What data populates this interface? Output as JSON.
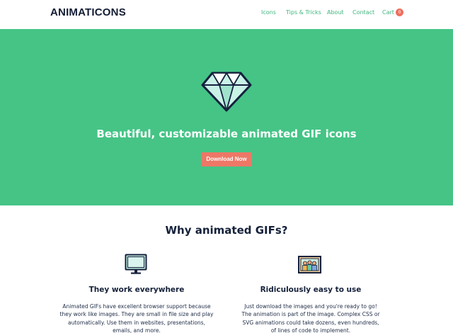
{
  "header": {
    "logo": "ANIMATICONS",
    "nav": {
      "icons": "Icons",
      "tips": "Tips & Tricks",
      "about": "About",
      "contact": "Contact",
      "cart": "Cart",
      "cart_count": "0"
    }
  },
  "hero": {
    "icon": "diamond-icon",
    "title": "Beautiful, customizable animated GIF icons",
    "button": "Download Now"
  },
  "why": {
    "title": "Why animated GIFs?",
    "features": [
      {
        "icon": "monitor-icon",
        "title": "They work everywhere",
        "text": "Animated GIFs have excellent browser support because they work like images. They are small in file size and play automatically. Use them in websites, presentations, emails, and more."
      },
      {
        "icon": "picture-icon",
        "title": "Ridiculously easy to use",
        "text": "Just download the images and you're ready to go! The animation is part of the image. Complex CSS or SVG animations could take dozens, even hundreds, of lines of code to implement."
      }
    ]
  },
  "colors": {
    "brand_green": "#45c486",
    "accent_red": "#ef6f5e",
    "dark_navy": "#15213a"
  }
}
